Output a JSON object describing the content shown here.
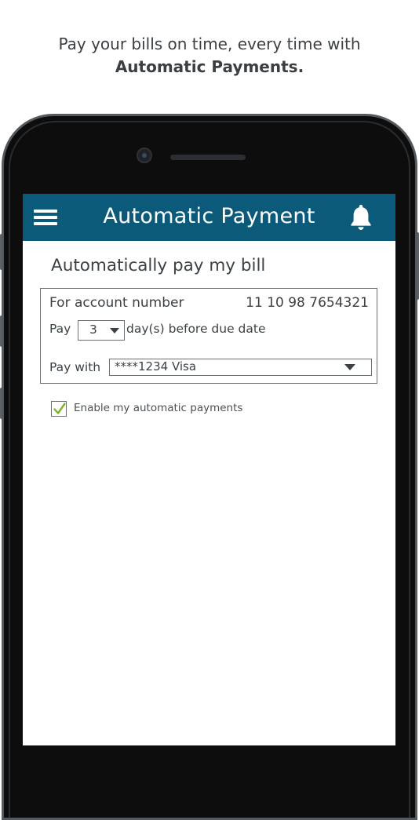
{
  "promo": {
    "line1": "Pay your bills on time, every time with",
    "line2": "Automatic Payments."
  },
  "appbar": {
    "title": "Automatic Payment",
    "menu_icon": "hamburger-menu-icon",
    "notification_icon": "bell-icon",
    "background_color": "#0b5a7a"
  },
  "form": {
    "section_title": "Automatically pay my bill",
    "account_label": "For account number",
    "account_number": "11 10 98 7654321",
    "pay_label": "Pay",
    "days_value": "3",
    "days_suffix": "day(s) before due date",
    "pay_with_label": "Pay with",
    "payment_method": "****1234 Visa",
    "enable_label": "Enable my automatic payments",
    "enable_checked": true,
    "check_color": "#7ab51d"
  }
}
